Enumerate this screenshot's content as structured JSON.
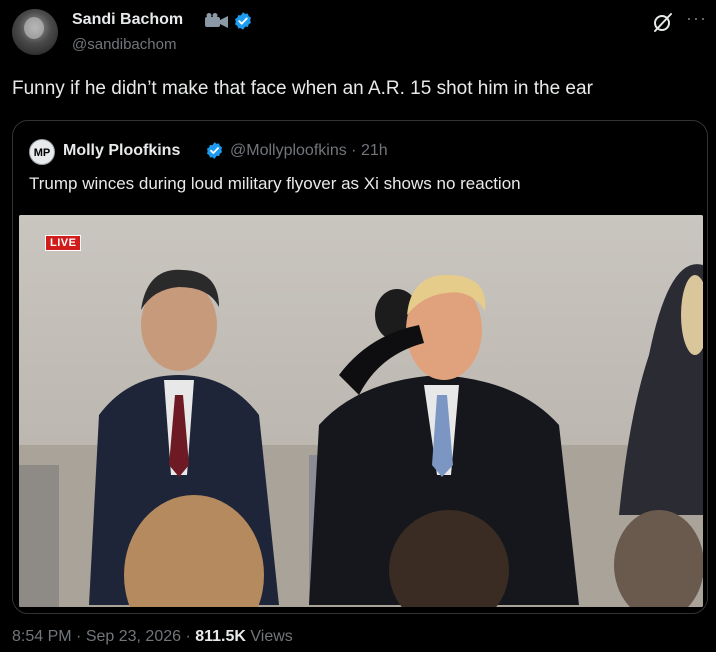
{
  "author": {
    "name": "Sandi Bachom",
    "handle": "@sandibachom",
    "avatar_icon": "avatar-photo",
    "badge_icons": [
      "camera-icon",
      "verified-icon"
    ]
  },
  "tweet": {
    "text": "Funny if he didn’t make that face when an A.R. 15 shot him in the ear"
  },
  "quote": {
    "avatar_text": "MP",
    "name": "Molly Ploofkins",
    "handle_time": "@Mollyploofkins · 21h",
    "text": "Trump winces during loud military flyover as Xi shows no reaction",
    "media": {
      "live_label": "LIVE",
      "description_icon": "video-thumbnail"
    }
  },
  "footer": {
    "time": "8:54 PM",
    "separator": " · ",
    "date": "Sep 23, 2026",
    "views_count": "811.5K",
    "views_label": "Views"
  },
  "colors": {
    "background": "#000000",
    "text": "#e7e9ea",
    "muted": "#71767b",
    "verified": "#1d9bf0",
    "border": "#2f3336",
    "live": "#d11c1c"
  },
  "header_icons": [
    "grok-icon",
    "more-icon"
  ]
}
